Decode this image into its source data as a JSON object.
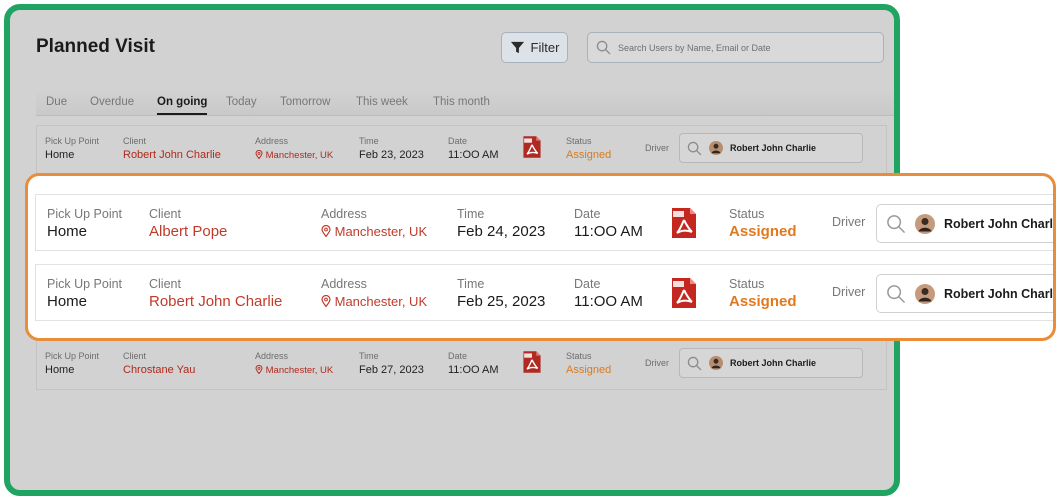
{
  "page": {
    "title": "Planned Visit"
  },
  "toolbar": {
    "filter_label": "Filter",
    "search_placeholder": "Search Users by Name, Email or Date"
  },
  "tabs": [
    {
      "label": "Due"
    },
    {
      "label": "Overdue"
    },
    {
      "label": "On going",
      "active": true
    },
    {
      "label": "Today"
    },
    {
      "label": "Tomorrow"
    },
    {
      "label": "This week"
    },
    {
      "label": "This month"
    }
  ],
  "labels": {
    "pickup": "Pick Up Point",
    "client": "Client",
    "address": "Address",
    "time": "Time",
    "date": "Date",
    "status": "Status",
    "driver": "Driver"
  },
  "visits": [
    {
      "pickup": "Home",
      "client": "Robert John Charlie",
      "address": "Manchester, UK",
      "time": "Feb 23, 2023",
      "date": "11:OO AM",
      "status": "Assigned",
      "driver": "Robert John Charlie"
    },
    {
      "pickup": "Home",
      "client": "Albert Pope",
      "address": "Manchester, UK",
      "time": "Feb 24, 2023",
      "date": "11:OO AM",
      "status": "Assigned",
      "driver": "Robert John Charlie"
    },
    {
      "pickup": "Home",
      "client": "Robert John Charlie",
      "address": "Manchester, UK",
      "time": "Feb 25, 2023",
      "date": "11:OO AM",
      "status": "Assigned",
      "driver": "Robert John Charlie"
    },
    {
      "pickup": "Home",
      "client": "Chrostane Yau",
      "address": "Manchester, UK",
      "time": "Feb 27, 2023",
      "date": "11:OO AM",
      "status": "Assigned",
      "driver": "Robert John Charlie"
    }
  ],
  "colors": {
    "frame_border": "#1fa462",
    "highlight_border": "#e88d3a",
    "client_red": "#c13b2b",
    "status_orange": "#e2791d",
    "pdf_red": "#c4271f"
  },
  "icons": {
    "filter": "funnel-icon",
    "search": "magnifier-icon",
    "location": "map-pin-icon",
    "document": "pdf-file-icon",
    "driver_avatar": "driver-avatar"
  }
}
